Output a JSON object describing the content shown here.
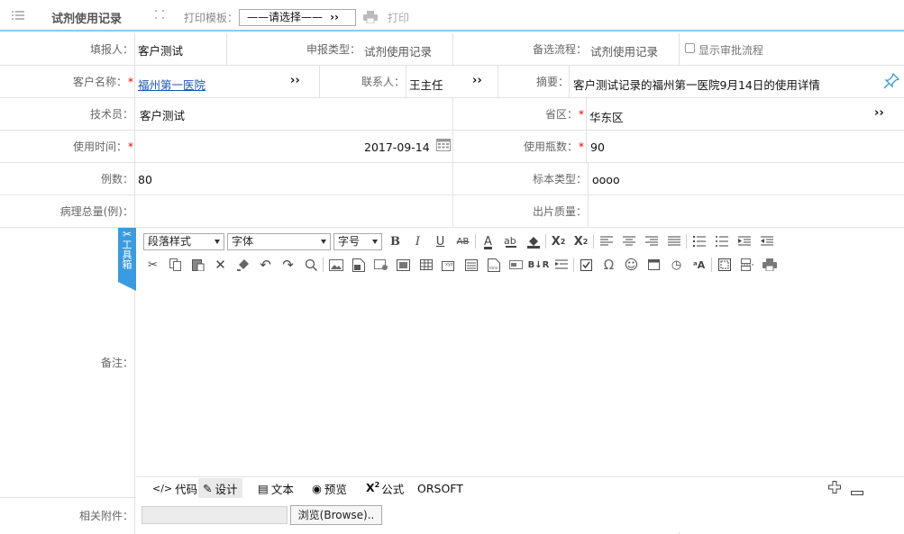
{
  "topbar": {
    "title": "试剂使用记录",
    "template_label": "打印模板：",
    "template_value": "——请选择——",
    "print_label": "打印"
  },
  "form": {
    "reporter_label": "填报人：",
    "reporter_value": "客户测试",
    "report_type_label": "申报类型：",
    "report_type_value": "试剂使用记录",
    "flow_label": "备选流程：",
    "flow_value": "试剂使用记录",
    "show_flow_label": "显示审批流程",
    "customer_label": "客户名称：",
    "customer_value": "福州第一医院",
    "contact_label": "联系人：",
    "contact_value": "王主任",
    "summary_label": "摘要：",
    "summary_value": "客户测试记录的福州第一医院9月14日的使用详情",
    "technician_label": "技术员：",
    "technician_value": "客户测试",
    "region_label": "省区：",
    "region_value": "华东区",
    "use_time_label": "使用时间：",
    "use_time_value": "2017-09-14",
    "bottles_label": "使用瓶数：",
    "bottles_value": "90",
    "cases_label": "例数：",
    "cases_value": "80",
    "specimen_label": "标本类型：",
    "specimen_value": "oooo",
    "pathology_label": "病理总量(例)：",
    "film_quality_label": "出片质量：",
    "remark_label": "备注：",
    "attachment_label": "相关附件：",
    "browse_label": "浏览(Browse).."
  },
  "editor": {
    "toolbox_label": "工具箱",
    "paragraph_style": "段落样式",
    "font": "字体",
    "font_size": "字号",
    "modes": [
      "代码",
      "设计",
      "文本",
      "预览",
      "公式",
      "ORSOFT"
    ]
  }
}
